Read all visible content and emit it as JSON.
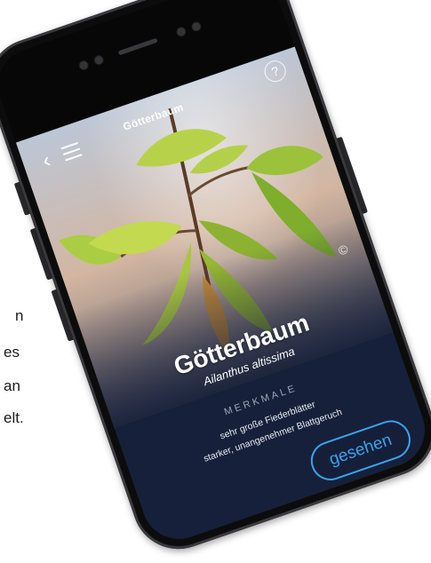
{
  "background_text": {
    "lines": [
      "n",
      "es",
      "an",
      "elt."
    ]
  },
  "app": {
    "back_icon": "chevron-left-icon",
    "menu_icon": "hamburger-menu-icon",
    "title": "Götterbaum",
    "help_label": "?",
    "copyright_label": "©"
  },
  "plant": {
    "common_name": "Götterbaum",
    "latin_name": "Ailanthus altissima"
  },
  "features": {
    "heading": "MERKMALE",
    "items": [
      "sehr große Fiederblätter",
      "starker, unangenehmer Blattgeruch"
    ]
  },
  "actions": {
    "seen_label": "gesehen"
  },
  "colors": {
    "accent": "#3aa3ee",
    "panel": "#16203a",
    "frame": "#0c0c0d"
  }
}
